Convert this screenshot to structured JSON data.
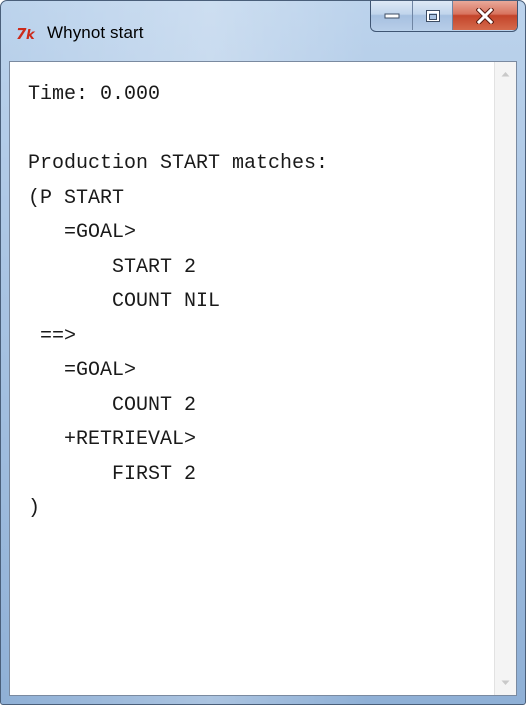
{
  "window": {
    "title": "Whynot start",
    "icon": "tk-feather-icon"
  },
  "caption_buttons": [
    "minimize-icon",
    "maximize-icon",
    "close-icon"
  ],
  "content": {
    "lines": [
      "Time: 0.000",
      "",
      "Production START matches:",
      "(P START",
      "   =GOAL>",
      "       START 2",
      "       COUNT NIL",
      " ==>",
      "   =GOAL>",
      "       COUNT 2",
      "   +RETRIEVAL>",
      "       FIRST 2",
      ")"
    ]
  },
  "colors": {
    "title_frame": "#a9c4e3",
    "close_button": "#c3442a",
    "text": "#1a1a1a",
    "text_background": "#ffffff"
  }
}
